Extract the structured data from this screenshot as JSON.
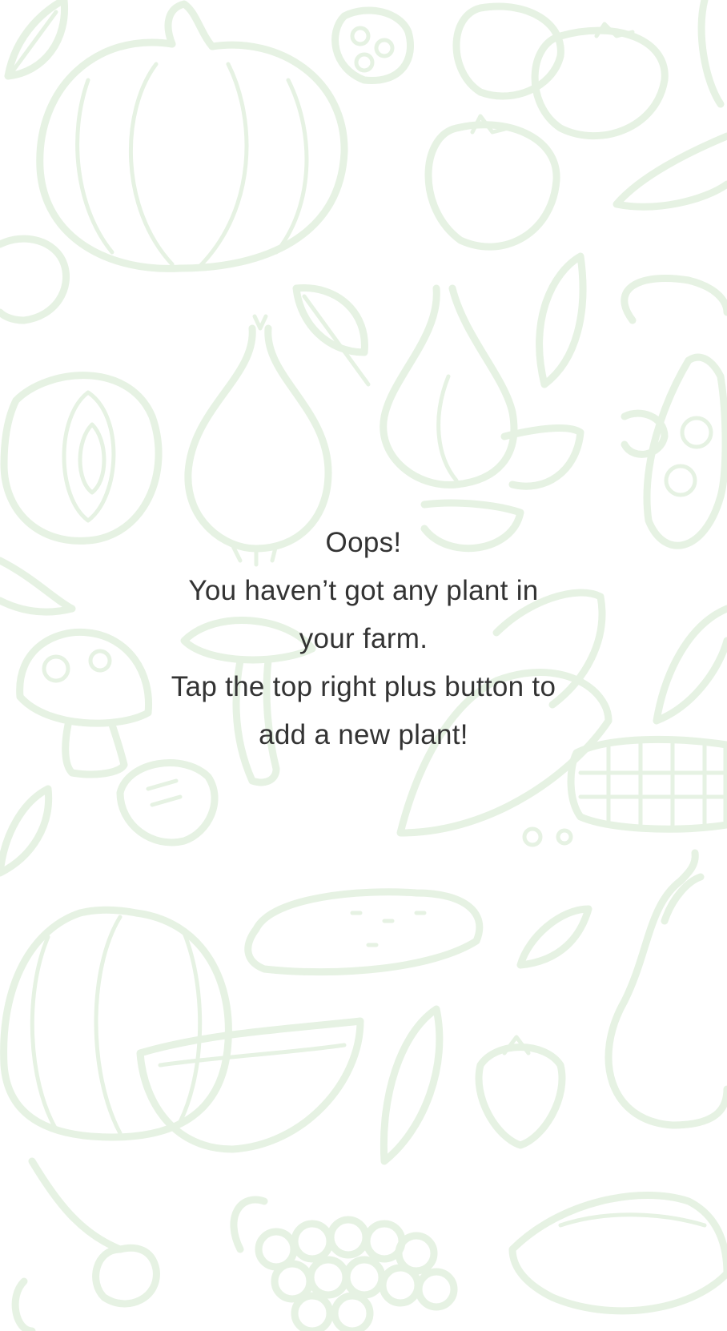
{
  "empty_state": {
    "title": "Oops!",
    "message_line_1": "You haven’t got any plant in",
    "message_line_2": "your farm.",
    "hint_line_1": "Tap the top right plus button to",
    "hint_line_2": "add a new plant!"
  },
  "background": {
    "doodle_color": "#e6f2e3",
    "text_color": "#333333",
    "page_color": "#ffffff"
  }
}
